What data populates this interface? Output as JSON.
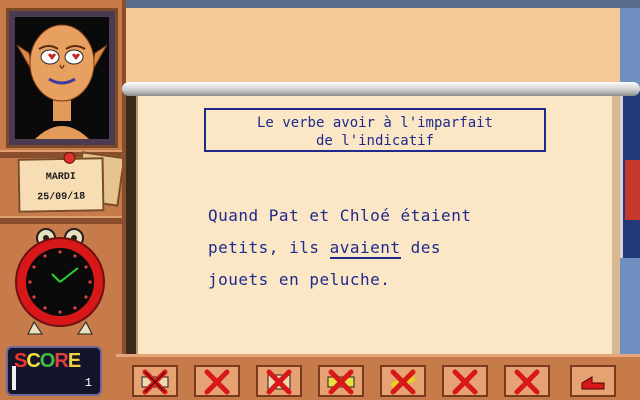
{
  "calendar": {
    "day": "MARDI",
    "date": "25/09/18"
  },
  "score": {
    "letters": [
      {
        "char": "S",
        "color": "#f03a2a"
      },
      {
        "char": "C",
        "color": "#f0e040"
      },
      {
        "char": "O",
        "color": "#40c040"
      },
      {
        "char": "R",
        "color": "#e04040"
      },
      {
        "char": "E",
        "color": "#f0d040"
      }
    ],
    "value": "1"
  },
  "lesson": {
    "title_line1": "Le verbe avoir à l'imparfait",
    "title_line2": "de l'indicatif",
    "line1": "Quand Pat et Chloé étaient",
    "line2_before": "petits, ils ",
    "line2_answer": "avaient",
    "line2_after": " des",
    "line3": "jouets en peluche."
  },
  "toolbar": {
    "buttons": [
      {
        "name": "answer-option-1",
        "icon": "red-x-icon"
      },
      {
        "name": "answer-option-2",
        "icon": "red-x-icon"
      },
      {
        "name": "answer-option-3",
        "icon": "red-x-icon"
      },
      {
        "name": "answer-option-4",
        "icon": "red-x-icon"
      },
      {
        "name": "answer-option-5",
        "icon": "red-x-icon"
      },
      {
        "name": "answer-option-6",
        "icon": "red-x-icon"
      },
      {
        "name": "answer-option-7",
        "icon": "red-x-icon"
      },
      {
        "name": "back-button",
        "icon": "return-arrow-icon"
      }
    ]
  },
  "colors": {
    "wood": "#c77a4a",
    "paper": "#fbe6c6",
    "text_blue": "#1e2a8c",
    "cross_red": "#d81818"
  }
}
